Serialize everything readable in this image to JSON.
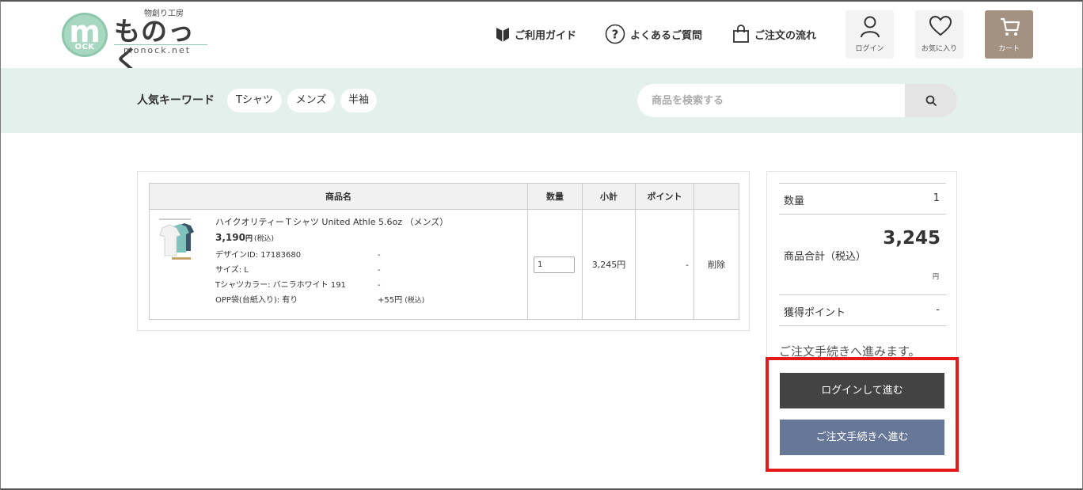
{
  "header": {
    "logo": {
      "small_text": "物創り工房",
      "main_text": "ものっく",
      "url_text": "monock.net",
      "mark_letter": "m",
      "mark_sub": "OCK"
    },
    "nav": [
      {
        "label": "ご利用ガイド",
        "icon": "beginner-mark-icon"
      },
      {
        "label": "よくあるご質問",
        "icon": "question-circle-icon"
      },
      {
        "label": "ご注文の流れ",
        "icon": "shopping-bag-icon"
      }
    ],
    "buttons": {
      "login": "ログイン",
      "favorites": "お気に入り",
      "cart": "カート"
    }
  },
  "search_band": {
    "keywords_title": "人気キーワード",
    "keywords": [
      "Tシャツ",
      "メンズ",
      "半袖"
    ],
    "search_placeholder": "商品を検索する"
  },
  "cart": {
    "headers": {
      "name": "商品名",
      "qty": "数量",
      "subtotal": "小計",
      "points": "ポイント",
      "action": ""
    },
    "item": {
      "name": "ハイクオリティーＴシャツ United Athle 5.6oz （メンズ）",
      "price": "3,190",
      "price_unit": "円",
      "tax_note": "(税込)",
      "options": [
        {
          "key": "デザインID: 17183680",
          "value": "-"
        },
        {
          "key": "サイズ: L",
          "value": "-"
        },
        {
          "key": "Tシャツカラー: バニラホワイト 191",
          "value": "-"
        },
        {
          "key": "OPP袋(台紙入り): 有り",
          "value": "+55円",
          "value_note": "(税込)"
        }
      ],
      "qty": "1",
      "subtotal": "3,245円",
      "points": "-",
      "delete_label": "削除"
    }
  },
  "summary": {
    "qty_label": "数量",
    "qty_value": "1",
    "total_label": "商品合計（税込）",
    "total_value": "3,245",
    "total_unit": "円",
    "points_label": "獲得ポイント",
    "points_value": "-",
    "proceed_text": "ご注文手続きへ進みます。",
    "login_button": "ログインして進む",
    "checkout_button": "ご注文手続きへ進む"
  },
  "colors": {
    "brand_green": "#a9d8c2",
    "band_bg": "#e4f0ec",
    "cart_button": "#a39182",
    "login_button": "#434343",
    "checkout_button": "#677798",
    "highlight": "#e51919",
    "link": "#2a5d96"
  }
}
